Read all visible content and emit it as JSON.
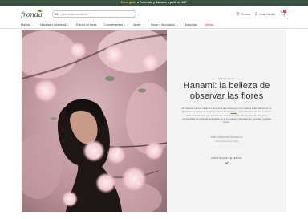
{
  "topbar": {
    "highlight": "Envío gratis",
    "text": " a Península y Baleares a partir de 49€*"
  },
  "header": {
    "logo": "fronda",
    "search_placeholder": "¿Qué estás buscando?",
    "tiendas_label": "Tiendas",
    "account_label": "Hola, Camila",
    "cart_count": "0"
  },
  "nav": {
    "items": [
      {
        "label": "Plantas",
        "has_dropdown": true
      },
      {
        "label": "Macetas y jardineras",
        "has_dropdown": true
      },
      {
        "label": "Ramos de flores",
        "has_dropdown": false
      },
      {
        "label": "Complementos",
        "has_dropdown": true
      },
      {
        "label": "Jardín",
        "has_dropdown": true
      },
      {
        "label": "Hogar y decoración",
        "has_dropdown": true
      },
      {
        "label": "Mascotas",
        "has_dropdown": false
      },
      {
        "label": "Ofertas",
        "has_dropdown": false
      }
    ]
  },
  "article": {
    "kicker": "BIENESTAR",
    "title": "Hanami: la belleza de observar las flores",
    "excerpt_start": "El Hanami es una tradición ancestral japonesa que nos invita a adentrarnos en la primavera a través de la observación de las ",
    "excerpt_link": "flores",
    "excerpt_end": ", especialmente de los cerezos. Esta celebración, que trasciende naturaleza y la cultura, nos da una gran oportunidad de celebrar la llegada de la primavera rodeados de muchas, muchas flores.",
    "author": "POR VANESSA MORENO",
    "date": "18 de febrero de 2024",
    "cta_label": "CONTINUAR LEYENDO"
  },
  "colors": {
    "brand_green": "#37523d",
    "accent_yellow": "#f4c64b",
    "sale_red": "#d6364a",
    "panel_bg": "#f3f3f3"
  }
}
